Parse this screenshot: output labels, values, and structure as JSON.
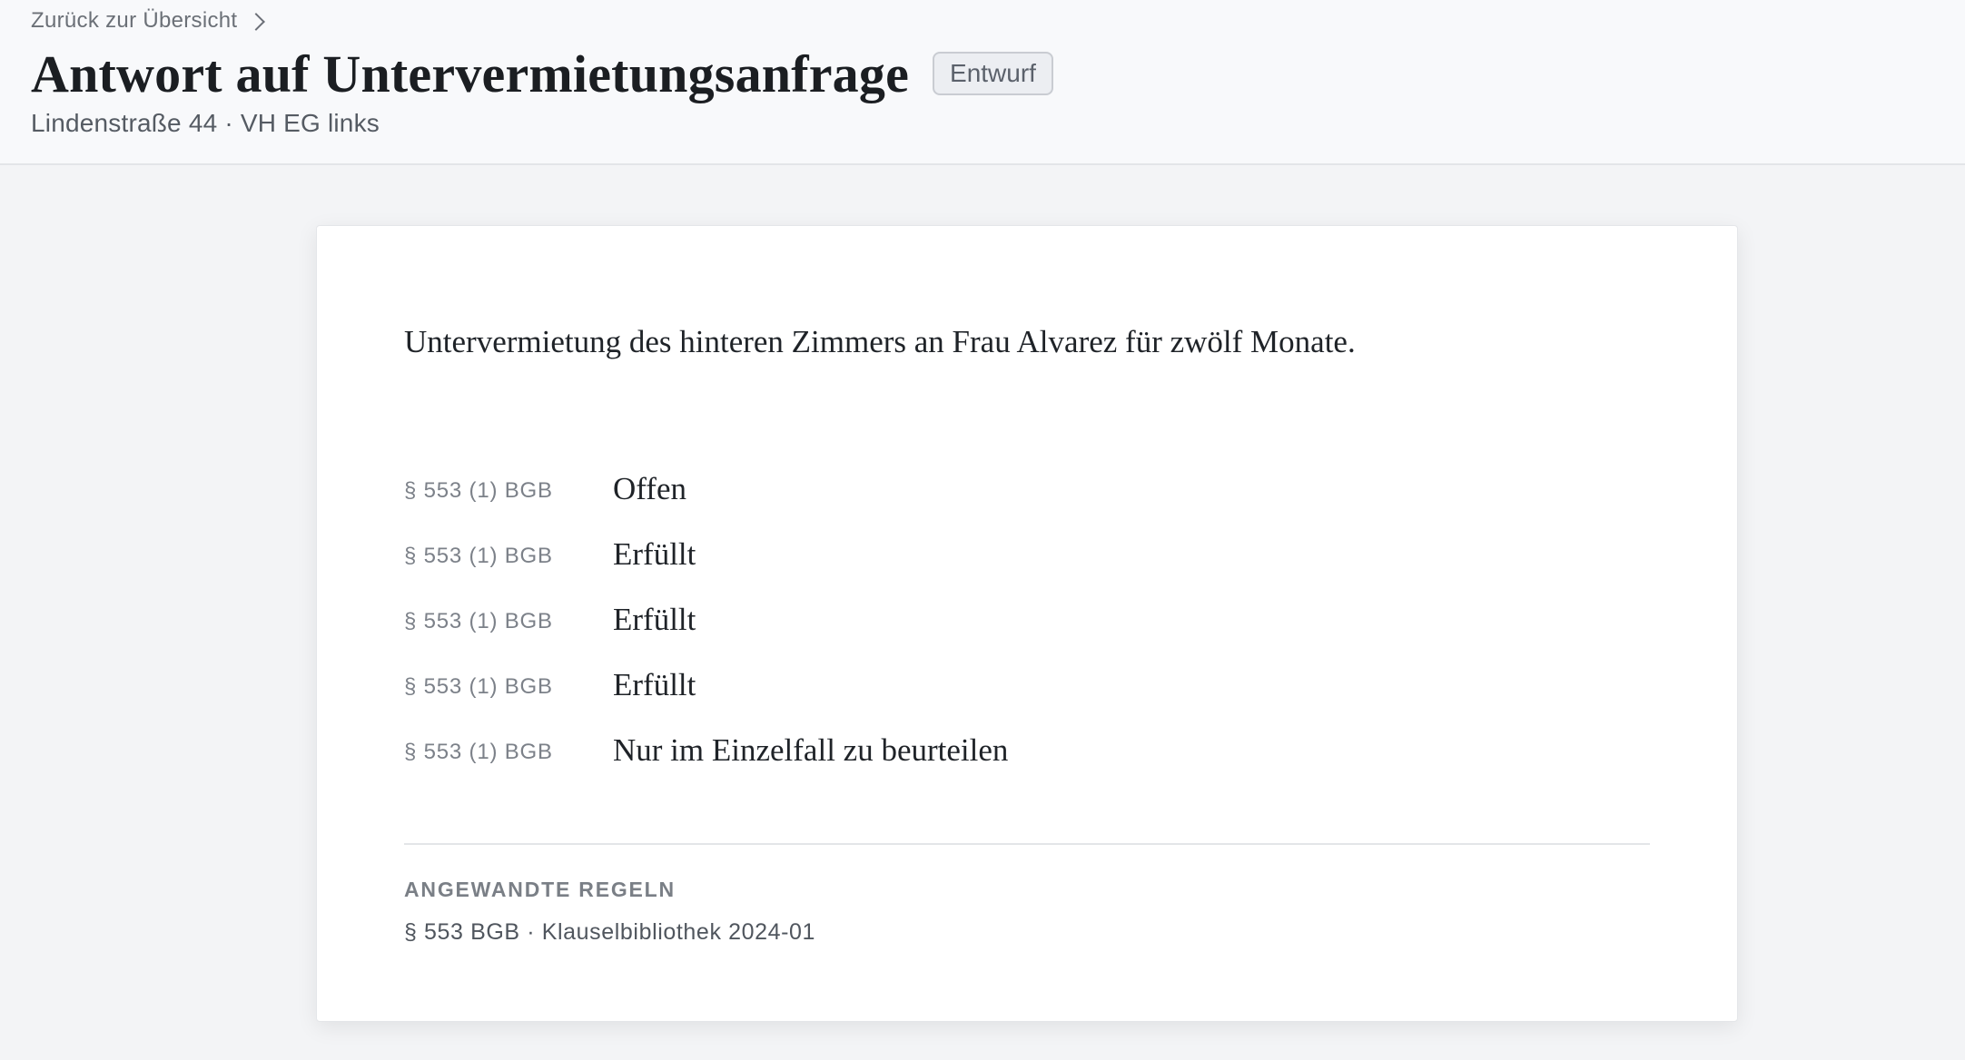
{
  "header": {
    "breadcrumb": "Zurück zur Übersicht",
    "title": "Antwort auf Untervermietungsanfrage",
    "status_badge": "Entwurf",
    "subtitle": "Lindenstraße 44 · VH EG links"
  },
  "card": {
    "summary": "Untervermietung des hinteren Zimmers an Frau Alvarez für zwölf Monate.",
    "checks": [
      {
        "ref": "§ 553 (1) BGB",
        "status": "Offen"
      },
      {
        "ref": "§ 553 (1) BGB",
        "status": "Erfüllt"
      },
      {
        "ref": "§ 553 (1) BGB",
        "status": "Erfüllt"
      },
      {
        "ref": "§ 553 (1) BGB",
        "status": "Erfüllt"
      },
      {
        "ref": "§ 553 (1) BGB",
        "status": "Nur im Einzelfall zu beurteilen"
      }
    ],
    "rules_label": "ANGEWANDTE REGELN",
    "rules_text": "§ 553 BGB · Klauselbibliothek 2024-01"
  },
  "icons": {
    "breadcrumb": "chevron-right-icon"
  },
  "colors": {
    "background": "#f3f4f6",
    "header_background": "#f8f9fb",
    "card_background": "#ffffff",
    "badge_background": "#eceef2",
    "badge_border": "#c9ccd2"
  }
}
